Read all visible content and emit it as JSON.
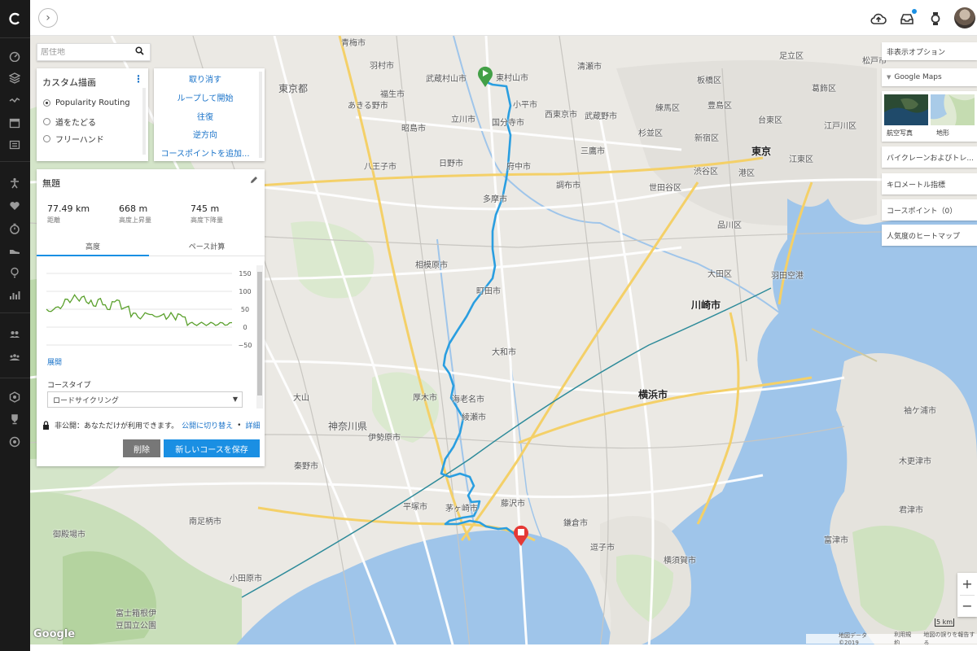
{
  "search": {
    "placeholder": "居住地"
  },
  "drawing": {
    "title": "カスタム描画",
    "options": [
      "Popularity Routing",
      "道をたどる",
      "フリーハンド"
    ]
  },
  "actions": [
    "取り消す",
    "ループして開始",
    "往復",
    "逆方向",
    "コースポイントを追加..."
  ],
  "course": {
    "title": "無題",
    "stats": [
      {
        "value": "77.49 km",
        "label": "距離"
      },
      {
        "value": "668 m",
        "label": "高度上昇量"
      },
      {
        "value": "745 m",
        "label": "高度下降量"
      }
    ],
    "tabs": [
      "高度",
      "ペース計算"
    ],
    "elevation_ticks": [
      "150",
      "100",
      "50",
      "0",
      "−50"
    ],
    "expand_label": "展開",
    "course_type_label": "コースタイプ",
    "course_type_value": "ロードサイクリング",
    "privacy_text": "非公開：あなただけが利用できます。",
    "privacy_switch": "公開に切り替え",
    "privacy_bullet": "•",
    "privacy_details": "詳細",
    "delete_label": "削除",
    "save_label": "新しいコースを保存"
  },
  "map_options": {
    "hide_options": "非表示オプション",
    "google_maps": "Google Maps",
    "aerial": "航空写真",
    "terrain": "地形",
    "bike_lanes": "バイクレーンおよびトレ...",
    "km_markers": "キロメートル指標",
    "course_points": "コースポイント（0）",
    "heatmap": "人気度のヒートマップ"
  },
  "map_labels": {
    "tokyo_to": "東京都",
    "kanagawa": "神奈川県",
    "tokyo": "東京",
    "yokohama": "横浜市",
    "kawasaki": "川崎市",
    "ome": "青梅市",
    "hamura": "羽村市",
    "fussa": "福生市",
    "akishima": "昭島市",
    "hachioji": "八王子市",
    "tachikawa": "立川市",
    "kokubunji": "国分寺市",
    "higashimurayama": "東村山市",
    "kodaira": "小平市",
    "fuchu": "府中市",
    "hino": "日野市",
    "tama": "多摩市",
    "machida": "町田市",
    "sagamihara": "相模原市",
    "yamato": "大和市",
    "ebina": "海老名市",
    "atsugi": "厚木市",
    "ayase": "綾瀬市",
    "isehara": "伊勢原市",
    "hiratsuka": "平塚市",
    "chigasaki": "茅ヶ崎市",
    "fujisawa": "藤沢市",
    "kamakura": "鎌倉市",
    "zushi": "逗子市",
    "yokosuka": "横須賀市",
    "odawara": "小田原市",
    "hadano": "秦野市",
    "minamiashigara": "南足柄市",
    "gotemba": "御殿場市",
    "setagaya": "世田谷区",
    "shibuya": "渋谷区",
    "shinjuku": "新宿区",
    "suginami": "杉並区",
    "nerima": "練馬区",
    "itabashi": "板橋区",
    "adachi": "足立区",
    "katsushika": "葛飾区",
    "edogawa": "江戸川区",
    "koto": "江東区",
    "shinagawa": "品川区",
    "ota": "大田区",
    "minato": "港区",
    "toshima": "豊島区",
    "taito": "台東区",
    "chofu": "調布市",
    "mitaka": "三鷹市",
    "musashino": "武蔵野市",
    "nishitokyo": "西東京市",
    "musashimurayama": "武蔵村山市",
    "akiruno": "あきる野市",
    "kiyose": "清瀬市",
    "matsudo": "松戸市",
    "haneda": "羽田空港",
    "sodegaura": "袖ケ浦市",
    "kisarazu": "木更津市",
    "kimitsu": "君津市",
    "futtsu": "富津市",
    "oyama": "大山",
    "fuji_hakone": "富士箱根伊豆国立公園"
  },
  "attribution": [
    "地図データ ©2019",
    "利用規約",
    "地図の誤りを報告する"
  ],
  "scale": "5 km",
  "google": "Google",
  "colors": {
    "accent": "#1a8fe3",
    "route": "#2a9ee0",
    "start": "#43a047",
    "end": "#e53935"
  }
}
